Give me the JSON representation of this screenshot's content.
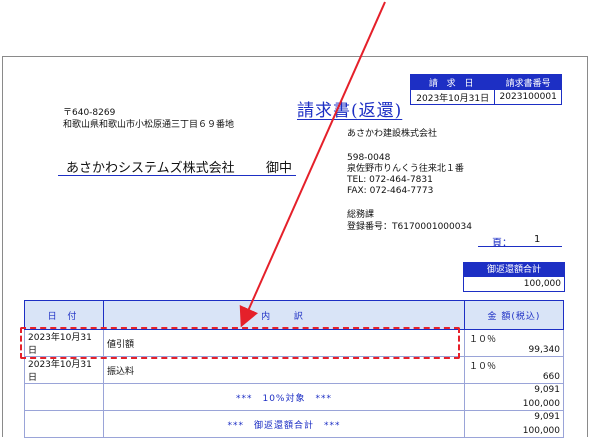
{
  "header": {
    "date_label": "請 求 日",
    "number_label": "請求書番号",
    "date_value": "2023年10月31日",
    "number_value": "2023100001"
  },
  "title": "請求書(返還)",
  "customer": {
    "postal": "〒640-8269",
    "address": "和歌山県和歌山市小松原通三丁目６９番地",
    "name": "あさかわシステムズ株式会社",
    "honorific": "御中"
  },
  "issuer": {
    "company": "あさかわ建設株式会社",
    "postal": "598-0048",
    "address": "泉佐野市りんくう往来北１番",
    "tel": "TEL: 072-464-7831",
    "fax": "FAX: 072-464-7773",
    "dept": "総務課",
    "reg_no": "登録番号：T6170001000034"
  },
  "page": {
    "label": "頁：",
    "value": "1"
  },
  "total": {
    "label": "御返還額合計",
    "value": "100,000"
  },
  "table": {
    "headers": {
      "date": "日 付",
      "desc": "内　 訳",
      "amount": "金 額(税込)"
    },
    "rows": [
      {
        "date": "2023年10月31日",
        "desc": "値引額",
        "tax": "１０％",
        "amount": "99,340"
      },
      {
        "date": "2023年10月31日",
        "desc": "振込料",
        "tax": "１０％",
        "amount": "660"
      }
    ],
    "sums": [
      {
        "desc": "***　10%対象　***",
        "v1": "9,091",
        "v2": "100,000"
      },
      {
        "desc": "***　御返還額合計　***",
        "v1": "9,091",
        "v2": "100,000"
      }
    ]
  },
  "colors": {
    "accent": "#1d2fc4",
    "highlight": "#e5202a"
  }
}
